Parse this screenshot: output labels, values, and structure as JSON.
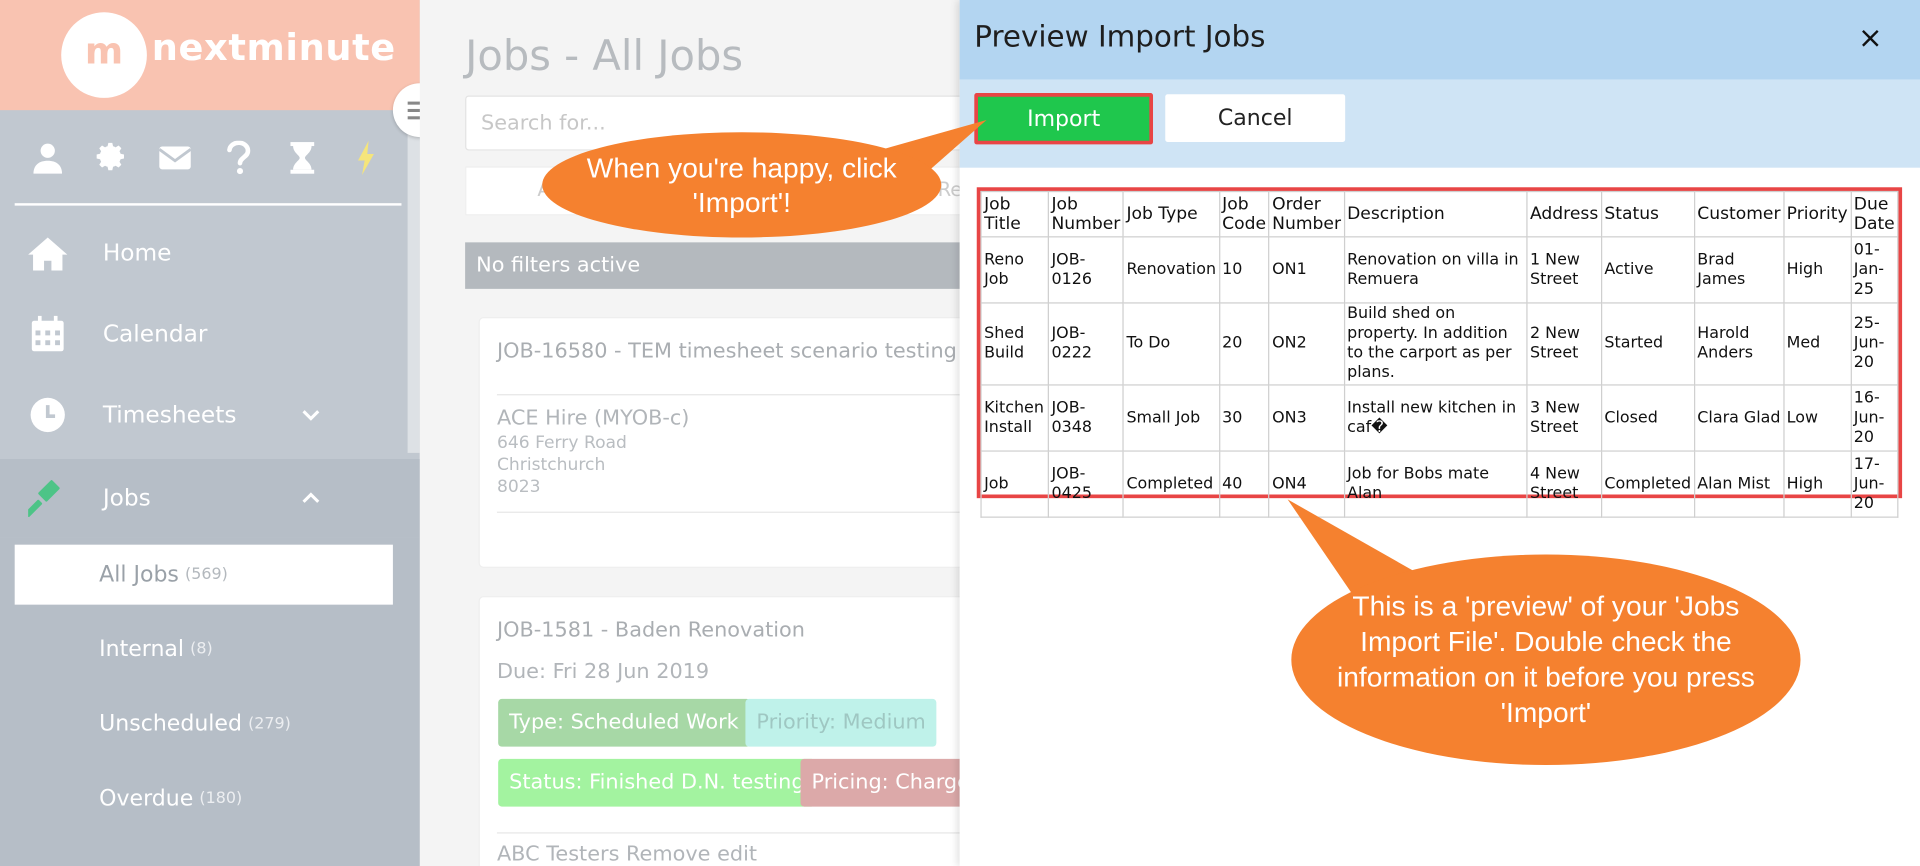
{
  "app": {
    "logo_mark": "m",
    "logo_text": "nextminute"
  },
  "sidebar": {
    "icons": [
      "user-icon",
      "gear-icon",
      "mail-icon",
      "question-icon",
      "hourglass-icon",
      "lightning-icon"
    ],
    "nav": {
      "home": "Home",
      "calendar": "Calendar",
      "timesheets": "Timesheets",
      "jobs": "Jobs"
    },
    "sub_items": [
      {
        "label": "All Jobs",
        "count": "(569)"
      },
      {
        "label": "Internal",
        "count": "(8)"
      },
      {
        "label": "Unscheduled",
        "count": "(279)"
      },
      {
        "label": "Overdue",
        "count": "(180)"
      }
    ]
  },
  "main": {
    "title": "Jobs - All Jobs",
    "search_placeholder": "Search for...",
    "tab_a": "A",
    "tab_r": "Re",
    "filters": "No filters active",
    "card1": {
      "title": "JOB-16580 - TEM timesheet scenario testing",
      "client": "ACE Hire (MYOB-c)",
      "address_line1": "646 Ferry Road",
      "address_line2": "Christchurch",
      "address_line3": "8023"
    },
    "card2": {
      "title": "JOB-1581 - Baden Renovation",
      "due": "Due: Fri 28 Jun 2019",
      "tags": {
        "type": "Type: Scheduled Work",
        "priority": "Priority: Medium",
        "status": "Status: Finished D.N. testing",
        "pricing": "Pricing: Charge"
      },
      "footer": "ABC Testers Remove edit"
    }
  },
  "modal": {
    "title": "Preview Import Jobs",
    "close": "×",
    "import_label": "Import",
    "cancel_label": "Cancel",
    "columns": [
      "Job Title",
      "Job Number",
      "Job Type",
      "Job Code",
      "Order Number",
      "Description",
      "Address",
      "Status",
      "Customer",
      "Priority",
      "Due Date"
    ],
    "rows": [
      [
        "Reno Job",
        "JOB-0126",
        "Renovation",
        "10",
        "ON1",
        "Renovation on villa in Remuera",
        "1 New Street",
        "Active",
        "Brad James",
        "High",
        "01-Jan-25"
      ],
      [
        "Shed Build",
        "JOB-0222",
        "To Do",
        "20",
        "ON2",
        "Build shed on property. In addition to the carport as per plans.",
        "2 New Street",
        "Started",
        "Harold Anders",
        "Med",
        "25-Jun-20"
      ],
      [
        "Kitchen Install",
        "JOB-0348",
        "Small Job",
        "30",
        "ON3",
        "Install new kitchen in caf�",
        "3 New Street",
        "Closed",
        "Clara Glad",
        "Low",
        "16-Jun-20"
      ],
      [
        "Job",
        "JOB-0425",
        "Completed",
        "40",
        "ON4",
        "Job for Bobs mate Alan",
        "4 New Street",
        "Completed",
        "Alan Mist",
        "High",
        "17-Jun-20"
      ]
    ]
  },
  "callouts": {
    "import_hint": "When you're happy, click 'Import'!",
    "preview_hint": "This is a 'preview' of your 'Jobs Import File'. Double check the information on it before you press 'Import'"
  },
  "colors": {
    "sidebar_bg": "#c1c8d0",
    "logo_bg": "#f9c3b1",
    "modal_header": "#b3d5f1",
    "import_green": "#1fc74d",
    "highlight_red": "#e84545",
    "callout_orange": "#f5812f"
  }
}
